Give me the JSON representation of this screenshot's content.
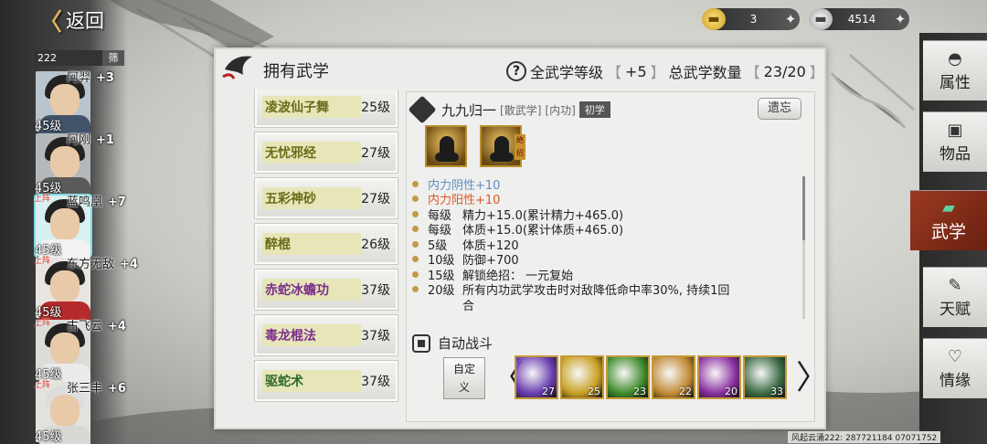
{
  "header": {
    "back_label": "返回"
  },
  "currency": {
    "gold": "3",
    "silver": "4514"
  },
  "roster": {
    "count": "222",
    "filter_label": "筛",
    "characters": [
      {
        "name": "阿羿",
        "bonus": "+3",
        "level": "45级",
        "deployed": ""
      },
      {
        "name": "阿刚",
        "bonus": "+1",
        "level": "45级",
        "deployed": ""
      },
      {
        "name": "蓝鸣凰",
        "bonus": "+7",
        "level": "45级",
        "deployed": "上阵"
      },
      {
        "name": "东方无敌",
        "bonus": "+4",
        "level": "45级",
        "deployed": "上阵"
      },
      {
        "name": "古飞云",
        "bonus": "+4",
        "level": "45级",
        "deployed": "上阵"
      },
      {
        "name": "张三丰",
        "bonus": "+6",
        "level": "45级",
        "deployed": "上阵"
      }
    ]
  },
  "panel": {
    "title": "拥有武学",
    "summary_all_level_label": "全武学等级",
    "summary_all_level_value": "+5",
    "summary_count_label": "总武学数量",
    "summary_count_value": "23/20",
    "bracket_open": "【",
    "bracket_close": "】"
  },
  "skills": [
    {
      "name": "凌波仙子舞",
      "level": "25级",
      "color": "olive"
    },
    {
      "name": "无忧邪经",
      "level": "27级",
      "color": "olive"
    },
    {
      "name": "五彩神砂",
      "level": "27级",
      "color": "olive"
    },
    {
      "name": "醉棍",
      "level": "26级",
      "color": "olive"
    },
    {
      "name": "赤蛇冰蟾功",
      "level": "37级",
      "color": "purple"
    },
    {
      "name": "毒龙棍法",
      "level": "37级",
      "color": "purple"
    },
    {
      "name": "驱蛇术",
      "level": "37级",
      "color": "green"
    }
  ],
  "detail": {
    "name": "九九归一",
    "tag_type": "[散武学]",
    "tag_kind": "[内功]",
    "grade": "初学",
    "forget_label": "遗忘",
    "icon_tag": "绝招",
    "effects": [
      {
        "level": "",
        "text": "内力阴性+10",
        "style": "blue"
      },
      {
        "level": "",
        "text": "内力阳性+10",
        "style": "red"
      },
      {
        "level": "每级",
        "text": "精力+15.0(累计精力+465.0)",
        "style": ""
      },
      {
        "level": "每级",
        "text": "体质+15.0(累计体质+465.0)",
        "style": ""
      },
      {
        "level": "5级",
        "text": "体质+120",
        "style": ""
      },
      {
        "level": "10级",
        "text": "防御+700",
        "style": ""
      },
      {
        "level": "15级",
        "text": "解锁绝招：  一元复始",
        "style": ""
      },
      {
        "level": "20级",
        "text": "所有内功武学攻击时对敌降低命中率30%, 持续1回",
        "style": ""
      },
      {
        "level": "",
        "text": "合",
        "style": ""
      }
    ],
    "auto_battle_label": "自动战斗",
    "custom_label_line1": "自定",
    "custom_label_line2": "义",
    "moves": [
      {
        "count": "27",
        "color": "#6a3db0"
      },
      {
        "count": "25",
        "color": "#c9a024"
      },
      {
        "count": "23",
        "color": "#3f8a2a"
      },
      {
        "count": "22",
        "color": "#c28a35"
      },
      {
        "count": "20",
        "color": "#8a2fa0"
      },
      {
        "count": "33",
        "color": "#3a6a44"
      }
    ]
  },
  "tabs": [
    {
      "label": "属性",
      "icon": "pouch-icon"
    },
    {
      "label": "物品",
      "icon": "box-icon"
    },
    {
      "label": "武学",
      "icon": "book-icon"
    },
    {
      "label": "天赋",
      "icon": "brush-icon"
    },
    {
      "label": "情缘",
      "icon": "heart-icon"
    }
  ],
  "footer": {
    "id_text": "风起云涌222: 287721184  07071752"
  }
}
